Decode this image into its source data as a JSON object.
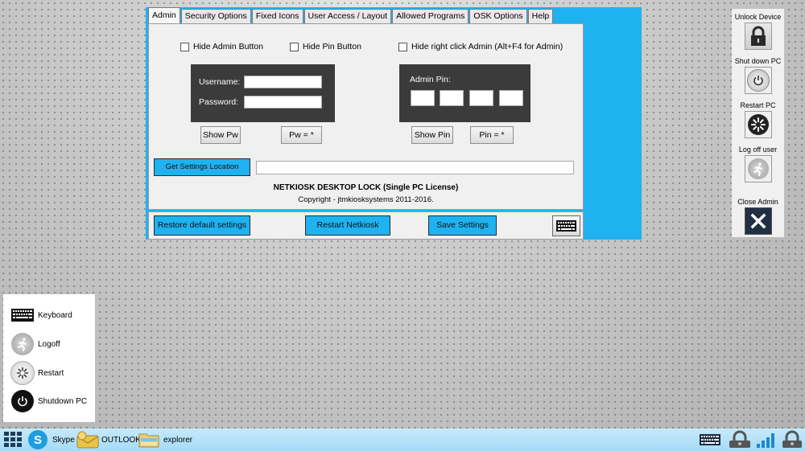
{
  "tabs": [
    "Admin",
    "Security Options",
    "Fixed Icons",
    "User Access / Layout",
    "Allowed Programs",
    "OSK Options",
    "Help"
  ],
  "active_tab": "Admin",
  "admin": {
    "hide_admin_button": "Hide Admin Button",
    "hide_pin_button": "Hide Pin Button",
    "hide_right_click": "Hide right click Admin (Alt+F4 for Admin)",
    "username_label": "Username:",
    "username_value": "",
    "password_label": "Password:",
    "password_value": "",
    "admin_pin_label": "Admin Pin:",
    "show_pw": "Show Pw",
    "pw_mask": "Pw = *",
    "show_pin": "Show Pin",
    "pin_mask": "Pin = *",
    "get_settings_location": "Get Settings Location",
    "settings_location_value": "",
    "product_title": "NETKIOSK DESKTOP LOCK (Single PC License)",
    "copyright": "Copyright - jtmkiosksystems 2011-2016."
  },
  "bottom_buttons": {
    "restore": "Restore default settings",
    "restart": "Restart Netkiosk",
    "save": "Save Settings"
  },
  "side_panel": {
    "unlock": "Unlock Device",
    "shutdown": "Shut down PC",
    "restart": "Restart PC",
    "logoff": "Log off user",
    "close_admin": "Close Admin"
  },
  "start_menu": {
    "keyboard": "Keyboard",
    "logoff": "Logoff",
    "restart": "Restart",
    "shutdown": "Shutdown PC"
  },
  "taskbar": {
    "skype": "Skype",
    "outlook": "OUTLOOK",
    "explorer": "explorer"
  },
  "colors": {
    "accent_blue": "#1eb3f0",
    "dark_panel": "#3b3b3b",
    "panel_bg": "#f0f0f0",
    "taskbar": "#a5dbf6"
  },
  "icons": [
    "lock-icon",
    "power-icon",
    "restart-spinner-icon",
    "logoff-runner-icon",
    "close-x-icon",
    "keyboard-icon",
    "start-grid-icon",
    "skype-icon",
    "outlook-icon",
    "explorer-folder-icon",
    "network-lock-icon",
    "signal-bars-icon"
  ]
}
